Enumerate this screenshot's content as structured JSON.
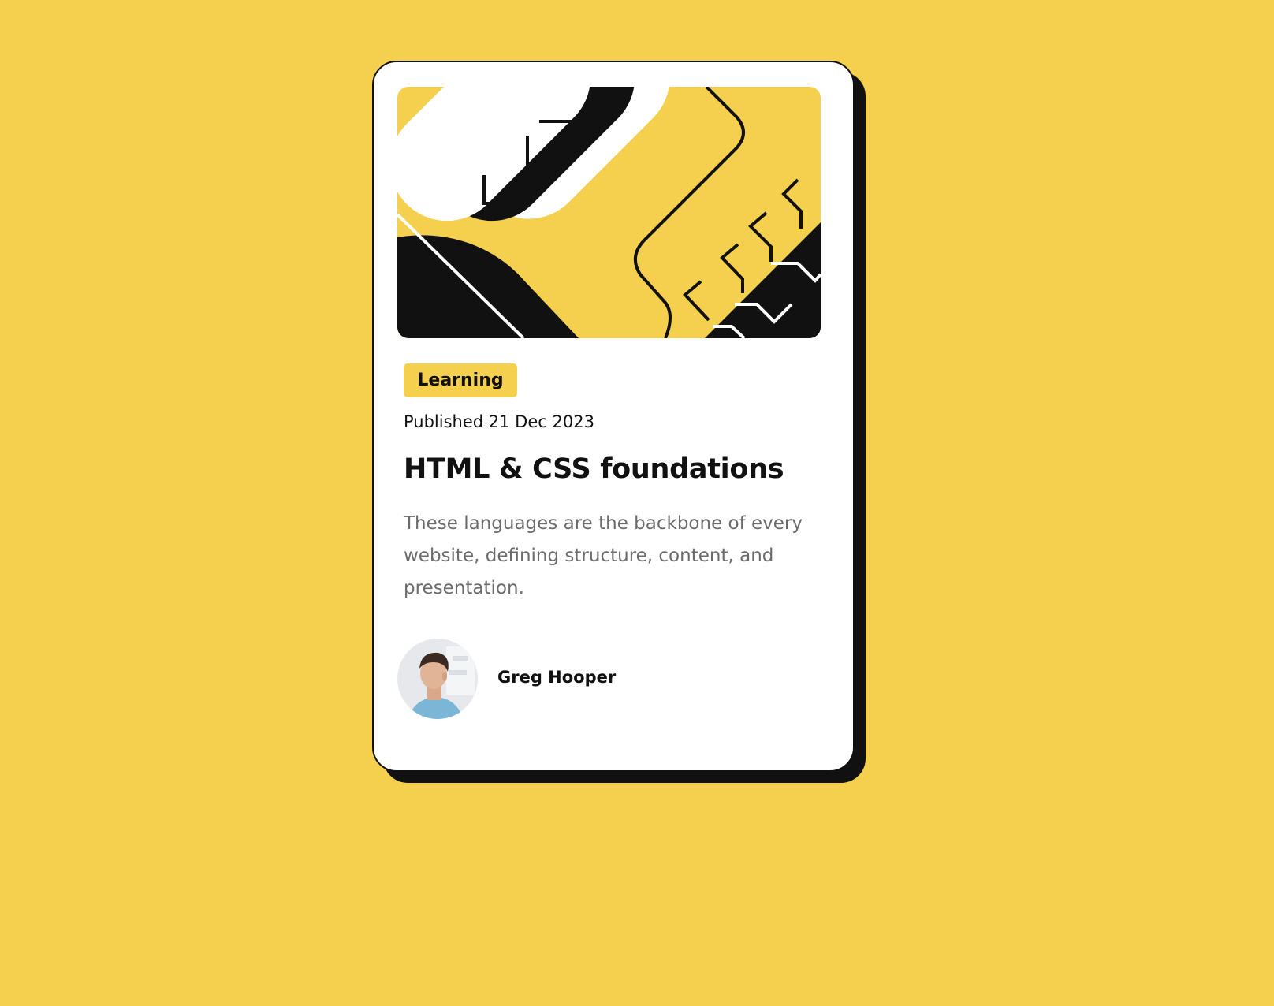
{
  "colors": {
    "background": "#F4D04E",
    "card": "#FFFFFF",
    "ink": "#111111",
    "muted": "#6B6B6B",
    "accent": "#F4D04E"
  },
  "hero": {
    "icon": "abstract-code-illustration"
  },
  "tag": {
    "label": "Learning"
  },
  "meta": {
    "published": "Published 21 Dec 2023"
  },
  "article": {
    "title": "HTML & CSS foundations",
    "description": "These languages are the backbone of every website, defining structure, content, and presentation."
  },
  "author": {
    "name": "Greg Hooper",
    "avatar_icon": "avatar-photo"
  }
}
